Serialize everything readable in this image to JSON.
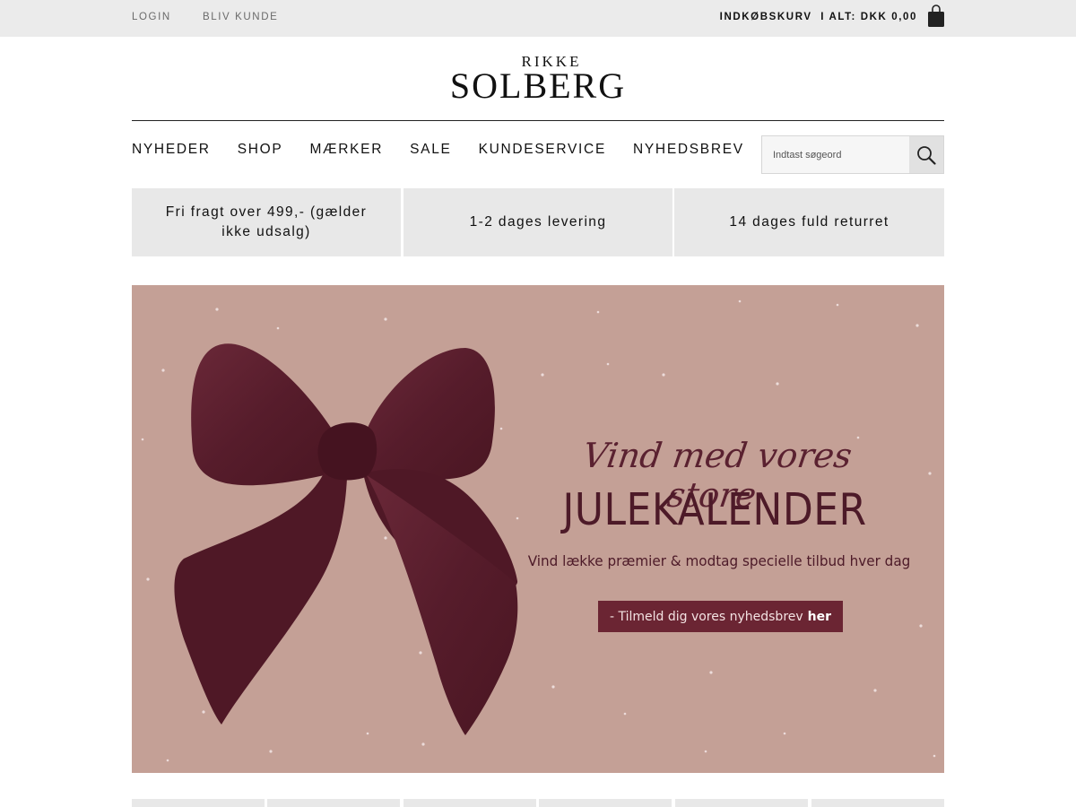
{
  "topbar": {
    "login": "LOGIN",
    "register": "BLIV KUNDE",
    "cart_label": "INDKØBSKURV",
    "cart_total": "I ALT: DKK 0,00",
    "cart_icon": "shopping-bag-icon"
  },
  "logo": {
    "line1": "RIKKE",
    "line2": "SOLBERG"
  },
  "nav": {
    "items": [
      "NYHEDER",
      "SHOP",
      "MÆRKER",
      "SALE",
      "KUNDESERVICE",
      "NYHEDSBREV"
    ]
  },
  "search": {
    "placeholder": "Indtast søgeord",
    "icon": "search-icon"
  },
  "usps": [
    "Fri fragt over 499,- (gælder ikke udsalg)",
    "1-2 dages levering",
    "14 dages fuld returret"
  ],
  "banner": {
    "script": "Vind med vores store",
    "headline": "JULEKALENDER",
    "subline": "Vind lække præmier & modtag specielle tilbud hver dag",
    "cta_prefix": "- Tilmeld dig vores nyhedsbrev",
    "cta_bold": "her",
    "background_color": "#c4a096",
    "bow_color": "#5a1f2d"
  }
}
